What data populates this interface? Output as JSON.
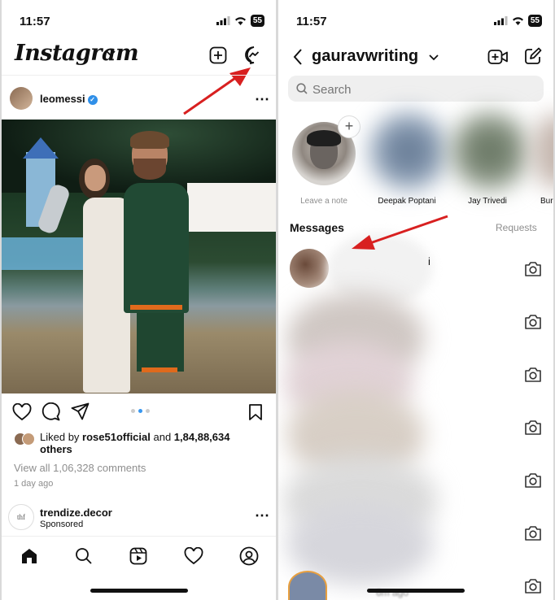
{
  "left": {
    "status": {
      "time": "11:57",
      "battery": "55"
    },
    "header": {
      "logo": "Instagram",
      "icons": [
        "chevron-down-icon",
        "new-post-icon",
        "messenger-icon"
      ]
    },
    "post": {
      "username": "leomessi",
      "liked_by_prefix": "Liked by ",
      "liked_by_user": "rose51official",
      "liked_by_and": " and ",
      "liked_by_count": "1,84,88,634",
      "liked_by_suffix": "others",
      "comments": "View all 1,06,328 comments",
      "time_ago": "1 day ago",
      "carousel_dots": 3,
      "carousel_active": 1
    },
    "sponsored": {
      "username": "trendize.decor",
      "label": "Sponsored",
      "logo_text": "thf"
    },
    "nav": [
      "home-icon",
      "search-icon",
      "reels-icon",
      "heart-icon",
      "profile-icon"
    ]
  },
  "right": {
    "status": {
      "time": "11:57",
      "battery": "55"
    },
    "header": {
      "username": "gauravwriting"
    },
    "search": {
      "placeholder": "Search"
    },
    "notes": [
      {
        "label": "Leave a note"
      },
      {
        "label": "Deepak Poptani"
      },
      {
        "label": "Jay Trivedi"
      },
      {
        "label": "Bur"
      }
    ],
    "messages": {
      "title": "Messages",
      "requests": "Requests",
      "partial_name_char": "i",
      "bottom_time": "6m ago"
    },
    "colors": {
      "arrow": "#d82020",
      "verified": "#2f8fe8",
      "requests": "#8e8e8e"
    }
  }
}
